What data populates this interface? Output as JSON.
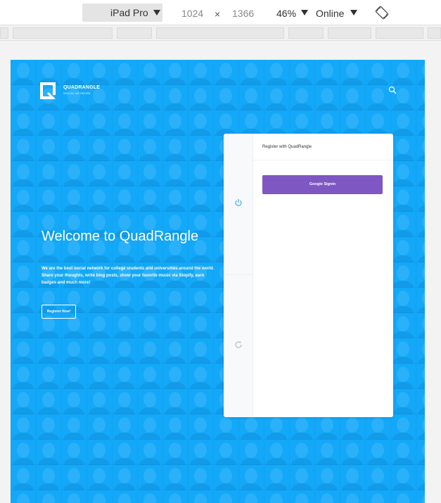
{
  "devtools": {
    "device": "iPad Pro",
    "width": "1024",
    "times": "×",
    "height": "1366",
    "zoom": "46%",
    "network": "Online",
    "rotate_icon": "rotate-icon"
  },
  "site": {
    "brand_name": "QUADRANGLE",
    "brand_tagline": "SOCIAL NETWORK",
    "headline": "Welcome to QuadRangle",
    "description": "We are the best social network for college students and universities around the world. Share your thoughts, write blog posts, show your favorite music via Stopify, earn badges and much more!",
    "register_button": "Register Now!",
    "accent_color": "#13a8f8"
  },
  "register_card": {
    "title": "Register with QuadRangle",
    "google_button": "Google Signin",
    "button_color": "#7e57c2",
    "side_icons": [
      "power-icon",
      "refresh-icon"
    ]
  }
}
